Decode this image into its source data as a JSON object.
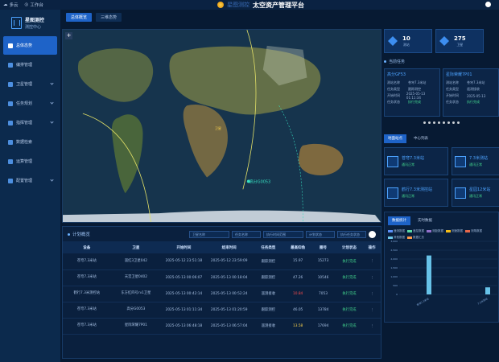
{
  "topbar": {
    "weather": "多云",
    "workspace": "工作台",
    "title_prefix": "星图测控",
    "title": "太空资产管理平台"
  },
  "sidebar": {
    "brand_title": "星图测控",
    "brand_sub": "测控中心",
    "items": [
      {
        "label": "总体态势",
        "active": true
      },
      {
        "label": "编排管理",
        "active": false
      },
      {
        "label": "卫星管理",
        "active": false
      },
      {
        "label": "任务规划",
        "active": false
      },
      {
        "label": "指挥管理",
        "active": false
      },
      {
        "label": "数据检索",
        "active": false
      },
      {
        "label": "运算管理",
        "active": false
      },
      {
        "label": "配置管理",
        "active": false
      }
    ]
  },
  "tabs": [
    {
      "label": "总体概览",
      "active": true
    },
    {
      "label": "三维态势",
      "active": false
    }
  ],
  "map": {
    "zoom_in": "+",
    "labels": [
      {
        "text": "高分G0053",
        "color": "#37e0c2"
      },
      {
        "text": "卫星",
        "color": "#ffd54d"
      }
    ]
  },
  "task_table": {
    "title": "计划概览",
    "filters": [
      "卫星名称",
      "任务名称",
      "执行时间范围",
      "计划状态",
      "执行任务状态"
    ],
    "columns": [
      "设备",
      "卫星",
      "开始时间",
      "结束时间",
      "任务类型",
      "最高仰角",
      "圈号",
      "计划状态",
      "操作"
    ],
    "rows": [
      {
        "device": "苍穹7.3米站",
        "sat": "遥红3卫星042",
        "start": "2025-05-12 23:51:18",
        "end": "2025-05-12 23:59:09",
        "type": "跟踪测控",
        "elev": "15.97",
        "elev_class": "",
        "orbit": "15273",
        "status": "执行完成",
        "op": "⋮"
      },
      {
        "device": "苍穹7.3米站",
        "sat": "天宫卫星0402",
        "start": "2025-05-13 00:06:07",
        "end": "2025-05-13 00:18:04",
        "type": "跟踪测控",
        "elev": "47.26",
        "elev_class": "",
        "orbit": "10546",
        "status": "执行完成",
        "op": "⋮"
      },
      {
        "device": "鹤行7.3米测控站",
        "sat": "东方红四号rv1卫星",
        "start": "2025-05-13 00:42:14",
        "end": "2025-05-13 00:52:24",
        "type": "遥测接收",
        "elev": "10.84",
        "elev_class": "red",
        "orbit": "7053",
        "status": "执行完成",
        "op": "⋮"
      },
      {
        "device": "苍穹7.3米站",
        "sat": "高分G0053",
        "start": "2025-05-13 01:11:34",
        "end": "2025-05-13 01:20:59",
        "type": "跟踪测控",
        "elev": "46.05",
        "elev_class": "",
        "orbit": "13784",
        "status": "执行完成",
        "op": "⋮"
      },
      {
        "device": "苍穹7.3米站",
        "sat": "星际荣耀7P01",
        "start": "2025-05-13 06:48:18",
        "end": "2025-05-13 06:57:04",
        "type": "遥测接收",
        "elev": "13.58",
        "elev_class": "yellow",
        "orbit": "17694",
        "status": "执行完成",
        "op": "⋮"
      }
    ]
  },
  "stats": [
    {
      "value": "10",
      "label": "测站"
    },
    {
      "value": "275",
      "label": "卫星"
    }
  ],
  "current_tasks": {
    "title": "当前任务",
    "cards": [
      {
        "name": "高分GF53",
        "rows": [
          [
            "测站名称",
            "苍穹7.3米站"
          ],
          [
            "任务类型",
            "跟踪测控"
          ],
          [
            "开始时间",
            "2025-05-13 01:11:34"
          ],
          [
            "任务状态",
            "执行完成"
          ]
        ]
      },
      {
        "name": "星际荣耀7P01",
        "rows": [
          [
            "测站名称",
            "苍穹7.3米站"
          ],
          [
            "任务类型",
            "遥测接收"
          ],
          [
            "开始时间",
            "2025-05-13"
          ],
          [
            "任务状态",
            "执行完成"
          ]
        ]
      }
    ]
  },
  "stations": {
    "tabs": [
      "地面站点",
      "中心列表"
    ],
    "items": [
      {
        "name": "苍穹7.3米站",
        "status": "通讯正常"
      },
      {
        "name": "7.3米测站",
        "status": "通讯正常"
      },
      {
        "name": "鹤行7.3米测控站",
        "status": "通讯正常"
      },
      {
        "name": "星园12米站",
        "status": "通讯正常"
      }
    ]
  },
  "data_stats": {
    "tabs": [
      "数据统计",
      "实时数据"
    ],
    "legend": [
      "遥测数据",
      "遥控数据",
      "测距数据",
      "测速数据",
      "测角数据",
      "其他数据",
      "数据汇总"
    ]
  },
  "chart_data": {
    "type": "bar",
    "categories": [
      "苍穹7.3米站",
      "7.3米测站"
    ],
    "values": [
      2200,
      400
    ],
    "ylim": [
      0,
      3000
    ],
    "yticks": [
      "3,000",
      "2,500",
      "2,000",
      "1,500",
      "1,000",
      "500",
      "0"
    ],
    "colors": [
      "#67c2e8",
      "#67c2e8"
    ]
  }
}
